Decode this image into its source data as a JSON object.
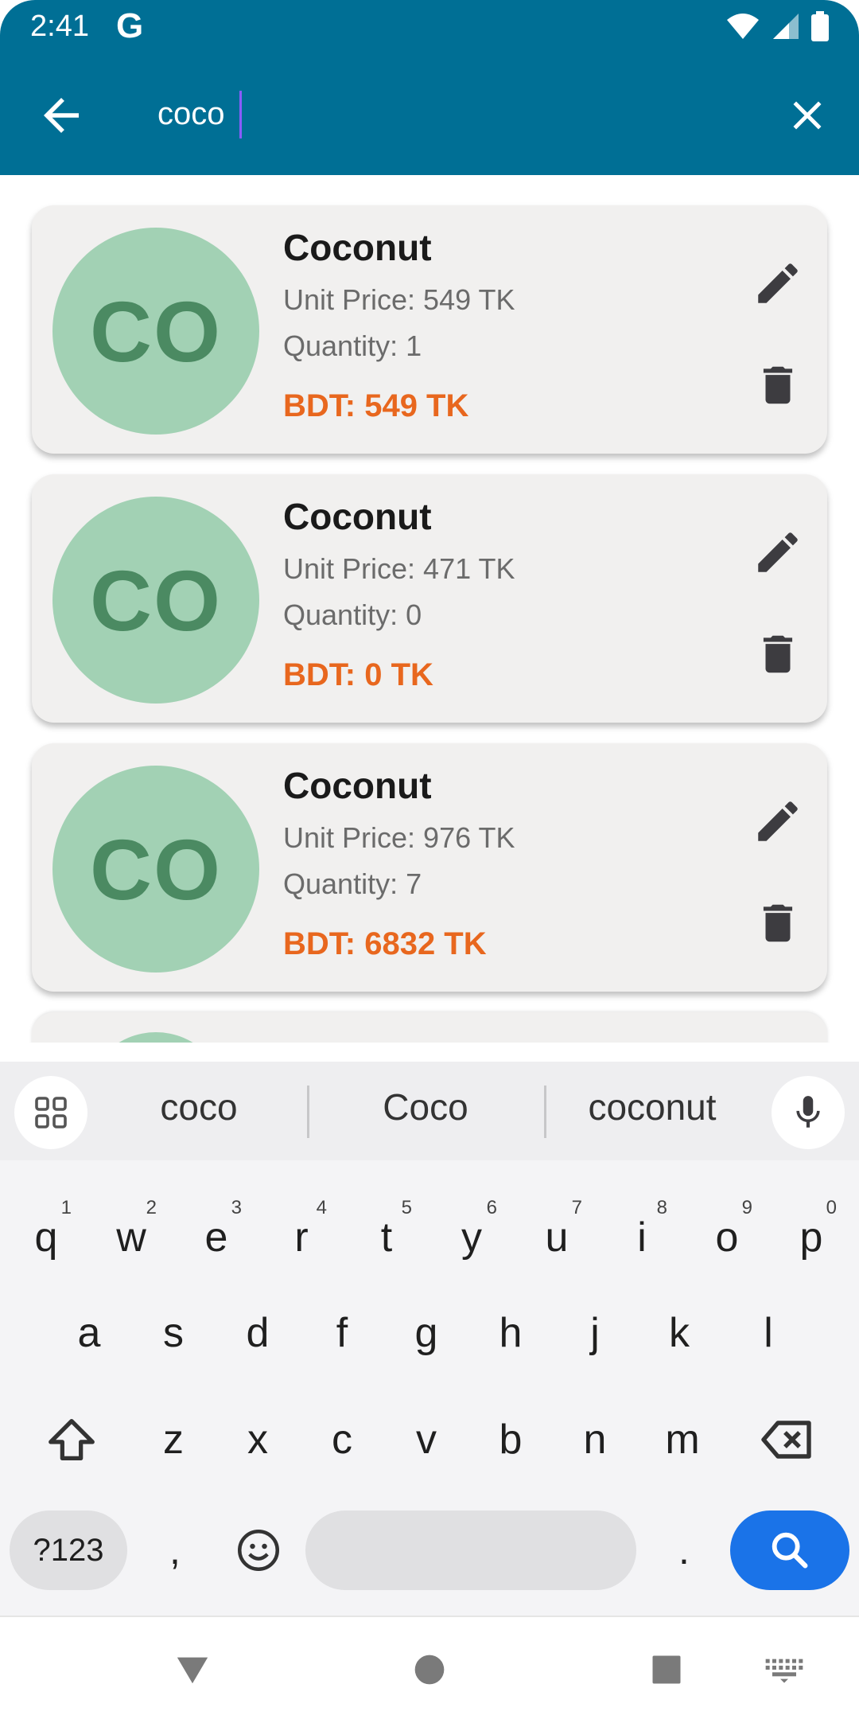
{
  "status": {
    "time": "2:41",
    "g_label": "G"
  },
  "search": {
    "value": "coco"
  },
  "items": [
    {
      "initials": "CO",
      "name": "Coconut",
      "unit_price": "Unit Price: 549 TK",
      "quantity": "Quantity: 1",
      "total": "BDT: 549 TK"
    },
    {
      "initials": "CO",
      "name": "Coconut",
      "unit_price": "Unit Price: 471 TK",
      "quantity": "Quantity: 0",
      "total": "BDT: 0 TK"
    },
    {
      "initials": "CO",
      "name": "Coconut",
      "unit_price": "Unit Price: 976 TK",
      "quantity": "Quantity: 7",
      "total": "BDT: 6832 TK"
    }
  ],
  "keyboard": {
    "suggestions": [
      "coco",
      "Coco",
      "coconut"
    ],
    "row1": [
      {
        "key": "q",
        "hint": "1"
      },
      {
        "key": "w",
        "hint": "2"
      },
      {
        "key": "e",
        "hint": "3"
      },
      {
        "key": "r",
        "hint": "4"
      },
      {
        "key": "t",
        "hint": "5"
      },
      {
        "key": "y",
        "hint": "6"
      },
      {
        "key": "u",
        "hint": "7"
      },
      {
        "key": "i",
        "hint": "8"
      },
      {
        "key": "o",
        "hint": "9"
      },
      {
        "key": "p",
        "hint": "0"
      }
    ],
    "row2": [
      "a",
      "s",
      "d",
      "f",
      "g",
      "h",
      "j",
      "k",
      "l"
    ],
    "row3": [
      "z",
      "x",
      "c",
      "v",
      "b",
      "n",
      "m"
    ],
    "symbols_label": "?123",
    "comma": ",",
    "period": "."
  },
  "colors": {
    "appbar": "#006f95",
    "avatar_bg": "#a2d1b4",
    "avatar_text": "#4b8a62",
    "total": "#e8671e",
    "search_key": "#1a73e8"
  },
  "icons": [
    "back-arrow-icon",
    "close-icon",
    "edit-pencil-icon",
    "trash-icon",
    "wifi-icon",
    "signal-icon",
    "battery-icon",
    "grid-icon",
    "mic-icon",
    "shift-icon",
    "backspace-icon",
    "emoji-icon",
    "search-icon",
    "nav-back-icon",
    "nav-home-icon",
    "nav-recents-icon",
    "keyboard-icon"
  ]
}
